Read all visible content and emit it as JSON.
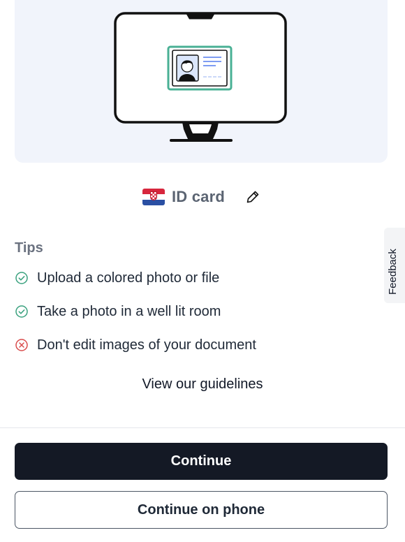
{
  "document": {
    "type_label": "ID card",
    "country_flag": "croatia-flag-icon",
    "edit_icon": "pencil-icon"
  },
  "tips": {
    "title": "Tips",
    "items": [
      {
        "text": "Upload a colored photo or file",
        "status": "do",
        "icon": "check-circle-icon",
        "color": "#3aa17e"
      },
      {
        "text": "Take a photo in a well lit room",
        "status": "do",
        "icon": "check-circle-icon",
        "color": "#3aa17e"
      },
      {
        "text": "Don't edit images of your document",
        "status": "dont",
        "icon": "x-circle-icon",
        "color": "#d94c4c"
      }
    ]
  },
  "guidelines_link": "View our guidelines",
  "actions": {
    "continue_label": "Continue",
    "continue_phone_label": "Continue on phone"
  },
  "feedback_label": "Feedback",
  "colors": {
    "panel_bg": "#f1f4fb",
    "primary_button": "#141925",
    "id_card_accent": "#49b094",
    "do_icon": "#3aa17e",
    "dont_icon": "#d94c4c"
  }
}
